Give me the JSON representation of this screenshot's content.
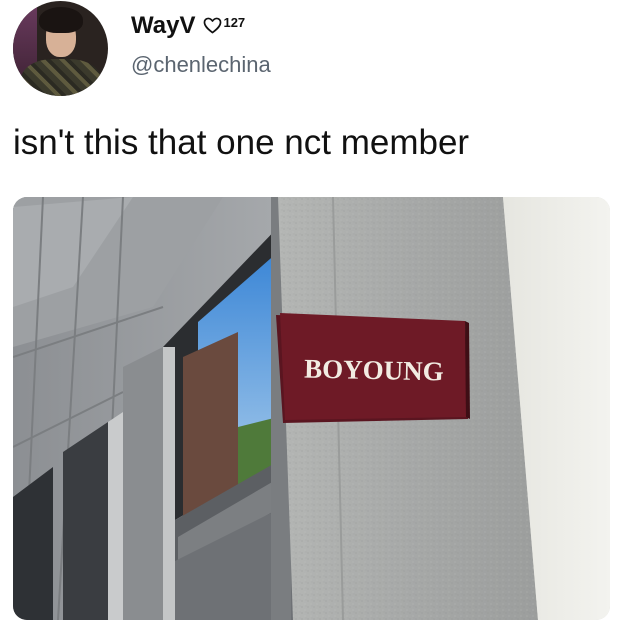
{
  "user": {
    "display_name": "WayV",
    "heart_number": "127",
    "handle": "@chenlechina",
    "avatar_icon": "profile-photo"
  },
  "tweet": {
    "text": "isn't this that one nct member"
  },
  "media": {
    "sign_text": "BOYOUNG",
    "sign_color": "#6e1a26"
  },
  "colors": {
    "text": "#111111",
    "handle": "#5b6570"
  }
}
